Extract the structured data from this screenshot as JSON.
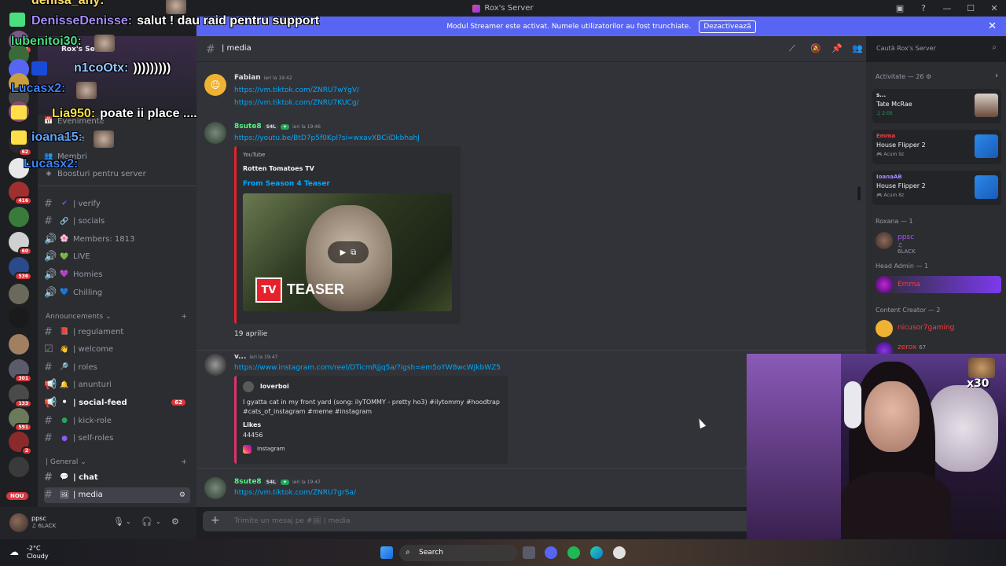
{
  "window": {
    "title": "Rox's Server",
    "min": "—",
    "max": "☐",
    "close": "✕"
  },
  "banner": {
    "text": "Modul Streamer este activat. Numele utilizatorilor au fost trunchiate.",
    "button": "Dezactivează",
    "close": "✕"
  },
  "servers": [
    {
      "badge": "295",
      "color": "#7a5a8a"
    },
    {
      "badge": "",
      "color": "#3a6a3a"
    },
    {
      "badge": "",
      "color": "#5865f2"
    },
    {
      "badge": "",
      "color": "#c8a040"
    },
    {
      "badge": "",
      "color": "#4a4a4a"
    },
    {
      "badge": "",
      "color": "#8a4a6a"
    },
    {
      "badge": "62",
      "color": "#2a2a2a"
    },
    {
      "badge": "",
      "color": "#e8e8e8"
    },
    {
      "badge": "416",
      "color": "#a03030"
    },
    {
      "badge": "",
      "color": "#3a7a3a"
    },
    {
      "badge": "60",
      "color": "#d0d0d0"
    },
    {
      "badge": "536",
      "color": "#2a4a8a"
    },
    {
      "badge": "",
      "color": "#6a6a5a"
    },
    {
      "badge": "",
      "color": "#1a1a1a"
    },
    {
      "badge": "",
      "color": "#a08060"
    },
    {
      "badge": "301",
      "color": "#5a5a6a"
    },
    {
      "badge": "133",
      "color": "#4a4a4a"
    },
    {
      "badge": "591",
      "color": "#6a7a5a"
    },
    {
      "badge": "2",
      "color": "#8a2a2a"
    },
    {
      "badge": "",
      "color": "#3a3a3a"
    }
  ],
  "nou": "NOU",
  "channels": {
    "server_name": "Rox's Server",
    "top_items": [
      {
        "label": "Evenimente",
        "icon": "📅"
      },
      {
        "label": "Canale",
        "icon": "≡"
      },
      {
        "label": "Membri",
        "icon": "👥"
      },
      {
        "label": "Boosturi pentru server",
        "icon": "◈"
      }
    ],
    "list1": [
      {
        "label": "| verify",
        "emoji": "✔",
        "ec": "#5865f2",
        "kind": "#"
      },
      {
        "label": "| socials",
        "emoji": "🔗",
        "ec": "#b5bac1",
        "kind": "#"
      },
      {
        "label": "Members: 1813",
        "emoji": "🌸",
        "ec": "#f472b6",
        "kind": "🔊"
      },
      {
        "label": "LIVE",
        "emoji": "💚",
        "ec": "#23a55a",
        "kind": "🔊"
      },
      {
        "label": "Homies",
        "emoji": "💜",
        "ec": "#a855f7",
        "kind": "🔊"
      },
      {
        "label": "Chilling",
        "emoji": "💙",
        "ec": "#3b82f6",
        "kind": "🔊"
      }
    ],
    "cat_announcements": "Announcements ⌄",
    "list2": [
      {
        "label": "| regulament",
        "emoji": "📕",
        "ec": "#e0e0e0",
        "kind": "#"
      },
      {
        "label": "| welcome",
        "emoji": "👋",
        "ec": "#f0c040",
        "kind": "☑"
      },
      {
        "label": "| roles",
        "emoji": "🔎",
        "ec": "#60a5fa",
        "kind": "#"
      },
      {
        "label": "| anunturi",
        "emoji": "🔔",
        "ec": "#f0c040",
        "kind": "📢"
      },
      {
        "label": "| social-feed",
        "emoji": "⚫",
        "ec": "#f2f3f5",
        "kind": "📢",
        "badge": "62",
        "unread": true
      },
      {
        "label": "| kick-role",
        "emoji": "●",
        "ec": "#23a55a",
        "kind": "#"
      },
      {
        "label": "| self-roles",
        "emoji": "●",
        "ec": "#8b5cf6",
        "kind": "#"
      }
    ],
    "cat_general": "| General ⌄",
    "list3": [
      {
        "label": "| chat",
        "emoji": "💬",
        "ec": "#f2f3f5",
        "kind": "#",
        "unread": true
      },
      {
        "label": "| media",
        "emoji": "🖼",
        "ec": "#f2f3f5",
        "kind": "#",
        "active": true
      }
    ],
    "plus": "+"
  },
  "user": {
    "name": "ppsc",
    "status": "♫ 6LACK"
  },
  "header": {
    "hash": "#",
    "channel": "| media"
  },
  "search": {
    "placeholder": "Caută Rox's Server"
  },
  "messages": {
    "m1": {
      "author": "Fabian",
      "time": "ieri la 19:42",
      "links": [
        "https://vm.tiktok.com/ZNRU7wYgV/",
        "https://vm.tiktok.com/ZNRU7KUCg/"
      ]
    },
    "m2": {
      "author": "8sute8",
      "tag": "S4L",
      "time": "ieri la 19:46",
      "link": "https://youtu.be/BtD7p5f0Kpl?si=wxavXBCiiDkbhahJ",
      "embed": {
        "provider": "YouTube",
        "title": "Rotten Tomatoes TV",
        "subtitle": "From Season 4 Teaser",
        "logo": "TV",
        "overlay": "TEASER"
      },
      "text": "19 aprilie"
    },
    "m3": {
      "author": "v...",
      "time": "ieri la 19:47",
      "link": "https://www.instagram.com/reel/DTicmRjjq5a/?igsh=em5oYW8wcWJkbWZ5",
      "embed": {
        "user": "loverboi",
        "text": "I gyatta cat in my front yard (song: ilyTOMMY - pretty ho3) #ilytommy #hoodtrap #cats_of_instagram #meme #instagram",
        "likes_label": "Likes",
        "likes": "44456",
        "provider": "Instagram"
      }
    },
    "m4": {
      "author": "8sute8",
      "tag": "S4L",
      "time": "ieri la 19:47",
      "link": "https://vm.tiktok.com/ZNRU7grSa/"
    }
  },
  "composer": {
    "placeholder": "Trimite un mesaj pe #🖼 | media"
  },
  "members": {
    "activity_head": "Activitate — 26 ⚙",
    "cards": [
      {
        "user": "s...",
        "uc": "#f2f3f5",
        "title": "Tate McRae",
        "sub": "♫ 2:05",
        "sc": "#23a55a"
      },
      {
        "user": "Emma",
        "uc": "#f23f42",
        "title": "House Flipper 2",
        "sub": "🎮 Acum 9z",
        "sc": "#949ba4"
      },
      {
        "user": "IoanaAB",
        "uc": "#a78bfa",
        "title": "House Flipper 2",
        "sub": "🎮 Acum 8z",
        "sc": "#949ba4"
      }
    ],
    "groups": {
      "roxana": "Roxana — 1",
      "headadmin": "Head Admin — 1",
      "creator": "Content Creator — 2"
    },
    "people": {
      "ppsc": {
        "name": "ppsc",
        "status": "♫ 6LACK"
      },
      "emma": {
        "name": "Emma"
      },
      "nicusor": {
        "name": "nicusor7gaming"
      },
      "zerox": {
        "name": "zerox",
        "extra": "67"
      }
    }
  },
  "overlay": {
    "lines": [
      {
        "text": "denisa_any:",
        "color": "#ffe066"
      },
      {
        "text": "DenisseDenisse:",
        "color": "#a78bfa",
        "msg": "salut ! dau raid pentru support"
      },
      {
        "text": "lubenitoi30:",
        "color": "#4ade80"
      },
      {
        "text": "n1coOtx:",
        "color": "#93c5fd",
        "msg": ")))))))))"
      },
      {
        "text": "Lucasx2:",
        "color": "#3b82f6"
      },
      {
        "text": "Lia950:",
        "color": "#fde047",
        "msg": "poate ii place ...."
      },
      {
        "text": "ioana15:",
        "color": "#60a5fa"
      },
      {
        "text": "Lucasx2:",
        "color": "#3b82f6"
      }
    ],
    "x30": "x30"
  },
  "taskbar": {
    "temp": "-2°C",
    "weather": "Cloudy",
    "search": "Search"
  }
}
